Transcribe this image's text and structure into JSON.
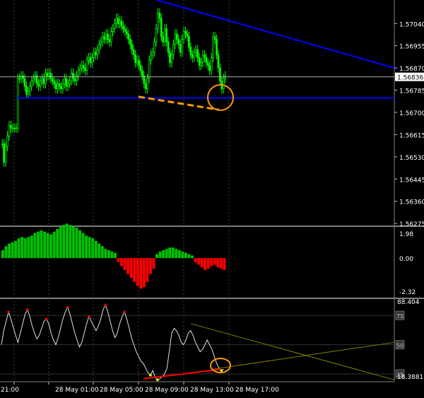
{
  "price_panel": {
    "price_labels": [
      "1.57040",
      "1.56955",
      "1.56870",
      "1.56785",
      "1.56700",
      "1.56615",
      "1.56530",
      "1.56445",
      "1.56360",
      "1.56275"
    ],
    "current_price": "1.56836"
  },
  "histogram_panel": {
    "labels": [
      "1.98",
      "0.00",
      "-2.32"
    ]
  },
  "oscillator_panel": {
    "labels": [
      "88.404",
      "18.3881"
    ],
    "level_labels": [
      "75",
      "50",
      "25"
    ]
  },
  "time_axis": {
    "labels": [
      "21:00",
      "28 May 01:00",
      "28 May 05:00",
      "28 May 09:00",
      "28 May 13:00",
      "28 May 17:00"
    ]
  },
  "colors": {
    "background": "#000000",
    "bull_candle": "#00ff00",
    "bear_candle": "#00ff00",
    "trendline": "#0000ff",
    "divergence_price": "#ff9900",
    "divergence_osc": "#ff0000",
    "hist_positive": "#00c000",
    "hist_negative": "#ff0000",
    "grid": "#c0c0c0",
    "axis_text": "#ffffff"
  },
  "chart_data": {
    "type": "candlestick",
    "x_range": [
      "21:00",
      "28 May 17:00"
    ],
    "price_range": [
      1.5627,
      1.5713
    ],
    "current_price": 1.56836,
    "candles_close": [
      1.5658,
      1.5651,
      1.5657,
      1.5661,
      1.5665,
      1.5664,
      1.5664,
      1.5664,
      1.5664,
      1.5683,
      1.5683,
      1.5684,
      1.5683,
      1.568,
      1.5677,
      1.5678,
      1.568,
      1.5682,
      1.5683,
      1.5684,
      1.5681,
      1.568,
      1.5682,
      1.5683,
      1.5681,
      1.5685,
      1.5684,
      1.5685,
      1.5683,
      1.5682,
      1.5681,
      1.5679,
      1.5681,
      1.568,
      1.5679,
      1.5681,
      1.5683,
      1.568,
      1.5681,
      1.5682,
      1.5685,
      1.5683,
      1.5682,
      1.5684,
      1.5686,
      1.5687,
      1.5688,
      1.5687,
      1.5686,
      1.569,
      1.5691,
      1.5689,
      1.5691,
      1.5693,
      1.5692,
      1.5694,
      1.5696,
      1.5697,
      1.5699,
      1.5698,
      1.57,
      1.5698,
      1.5697,
      1.5701,
      1.5702,
      1.5704,
      1.5706,
      1.5704,
      1.5705,
      1.5703,
      1.5702,
      1.5701,
      1.57,
      1.5698,
      1.5696,
      1.5694,
      1.5692,
      1.5689,
      1.569,
      1.5688,
      1.5686,
      1.5684,
      1.5681,
      1.5679,
      1.5683,
      1.569,
      1.5692,
      1.5693,
      1.5697,
      1.5702,
      1.5708,
      1.5706,
      1.5699,
      1.5697,
      1.5702,
      1.5697,
      1.5693,
      1.5689,
      1.5692,
      1.5696,
      1.57,
      1.5698,
      1.5696,
      1.5693,
      1.5698,
      1.5701,
      1.57,
      1.5699,
      1.5695,
      1.5692,
      1.5691,
      1.5693,
      1.5694,
      1.5691,
      1.5688,
      1.5689,
      1.5692,
      1.5691,
      1.5689,
      1.5688,
      1.5686,
      1.5691,
      1.5699,
      1.5698,
      1.5692,
      1.5687,
      1.5682,
      1.5679,
      1.5683,
      1.5684
    ],
    "trendlines": [
      {
        "color": "blue",
        "from_price": 1.5713,
        "to_price": 1.5687
      },
      {
        "color": "blue",
        "level": 1.56755
      }
    ],
    "divergence": {
      "price_from": 1.5676,
      "price_to": 1.5671,
      "osc_from": 21,
      "osc_to": 29
    },
    "histogram": {
      "range": [
        -2.32,
        1.98
      ],
      "values": [
        0.6,
        0.9,
        1.1,
        1.2,
        1.3,
        1.5,
        1.6,
        1.5,
        1.6,
        1.7,
        1.9,
        2.0,
        2.1,
        2.0,
        1.9,
        1.8,
        2.0,
        2.2,
        2.4,
        2.5,
        2.6,
        2.5,
        2.4,
        2.3,
        2.1,
        1.9,
        1.7,
        1.6,
        1.5,
        1.3,
        1.1,
        0.9,
        0.7,
        0.6,
        0.5,
        0.4,
        -0.3,
        -0.6,
        -0.9,
        -1.2,
        -1.5,
        -1.8,
        -2.1,
        -2.3,
        -2.2,
        -1.8,
        -1.2,
        -0.8,
        0.3,
        0.5,
        0.6,
        0.7,
        0.8,
        0.8,
        0.7,
        0.6,
        0.5,
        0.4,
        0.3,
        0.2,
        -0.3,
        -0.5,
        -0.7,
        -0.9,
        -0.8,
        -0.6,
        -0.5,
        -0.7,
        -0.8,
        -0.9
      ]
    },
    "oscillator": {
      "range": [
        18.3881,
        88.404
      ],
      "levels": [
        75,
        50,
        25
      ],
      "values": [
        50,
        62,
        70,
        78,
        72,
        65,
        58,
        52,
        60,
        68,
        76,
        80,
        74,
        66,
        60,
        55,
        58,
        64,
        70,
        72,
        68,
        60,
        54,
        50,
        56,
        64,
        72,
        78,
        82,
        76,
        68,
        60,
        54,
        48,
        52,
        60,
        68,
        74,
        70,
        66,
        62,
        66,
        72,
        80,
        84,
        78,
        70,
        62,
        56,
        60,
        68,
        74,
        78,
        72,
        64,
        56,
        50,
        44,
        40,
        36,
        34,
        30,
        26,
        24,
        28,
        22,
        20,
        21,
        23,
        25,
        30,
        45,
        60,
        64,
        62,
        58,
        52,
        50,
        54,
        60,
        62,
        58,
        52,
        48,
        44,
        46,
        50,
        54,
        50,
        46,
        40,
        34,
        30,
        28,
        29
      ]
    }
  }
}
